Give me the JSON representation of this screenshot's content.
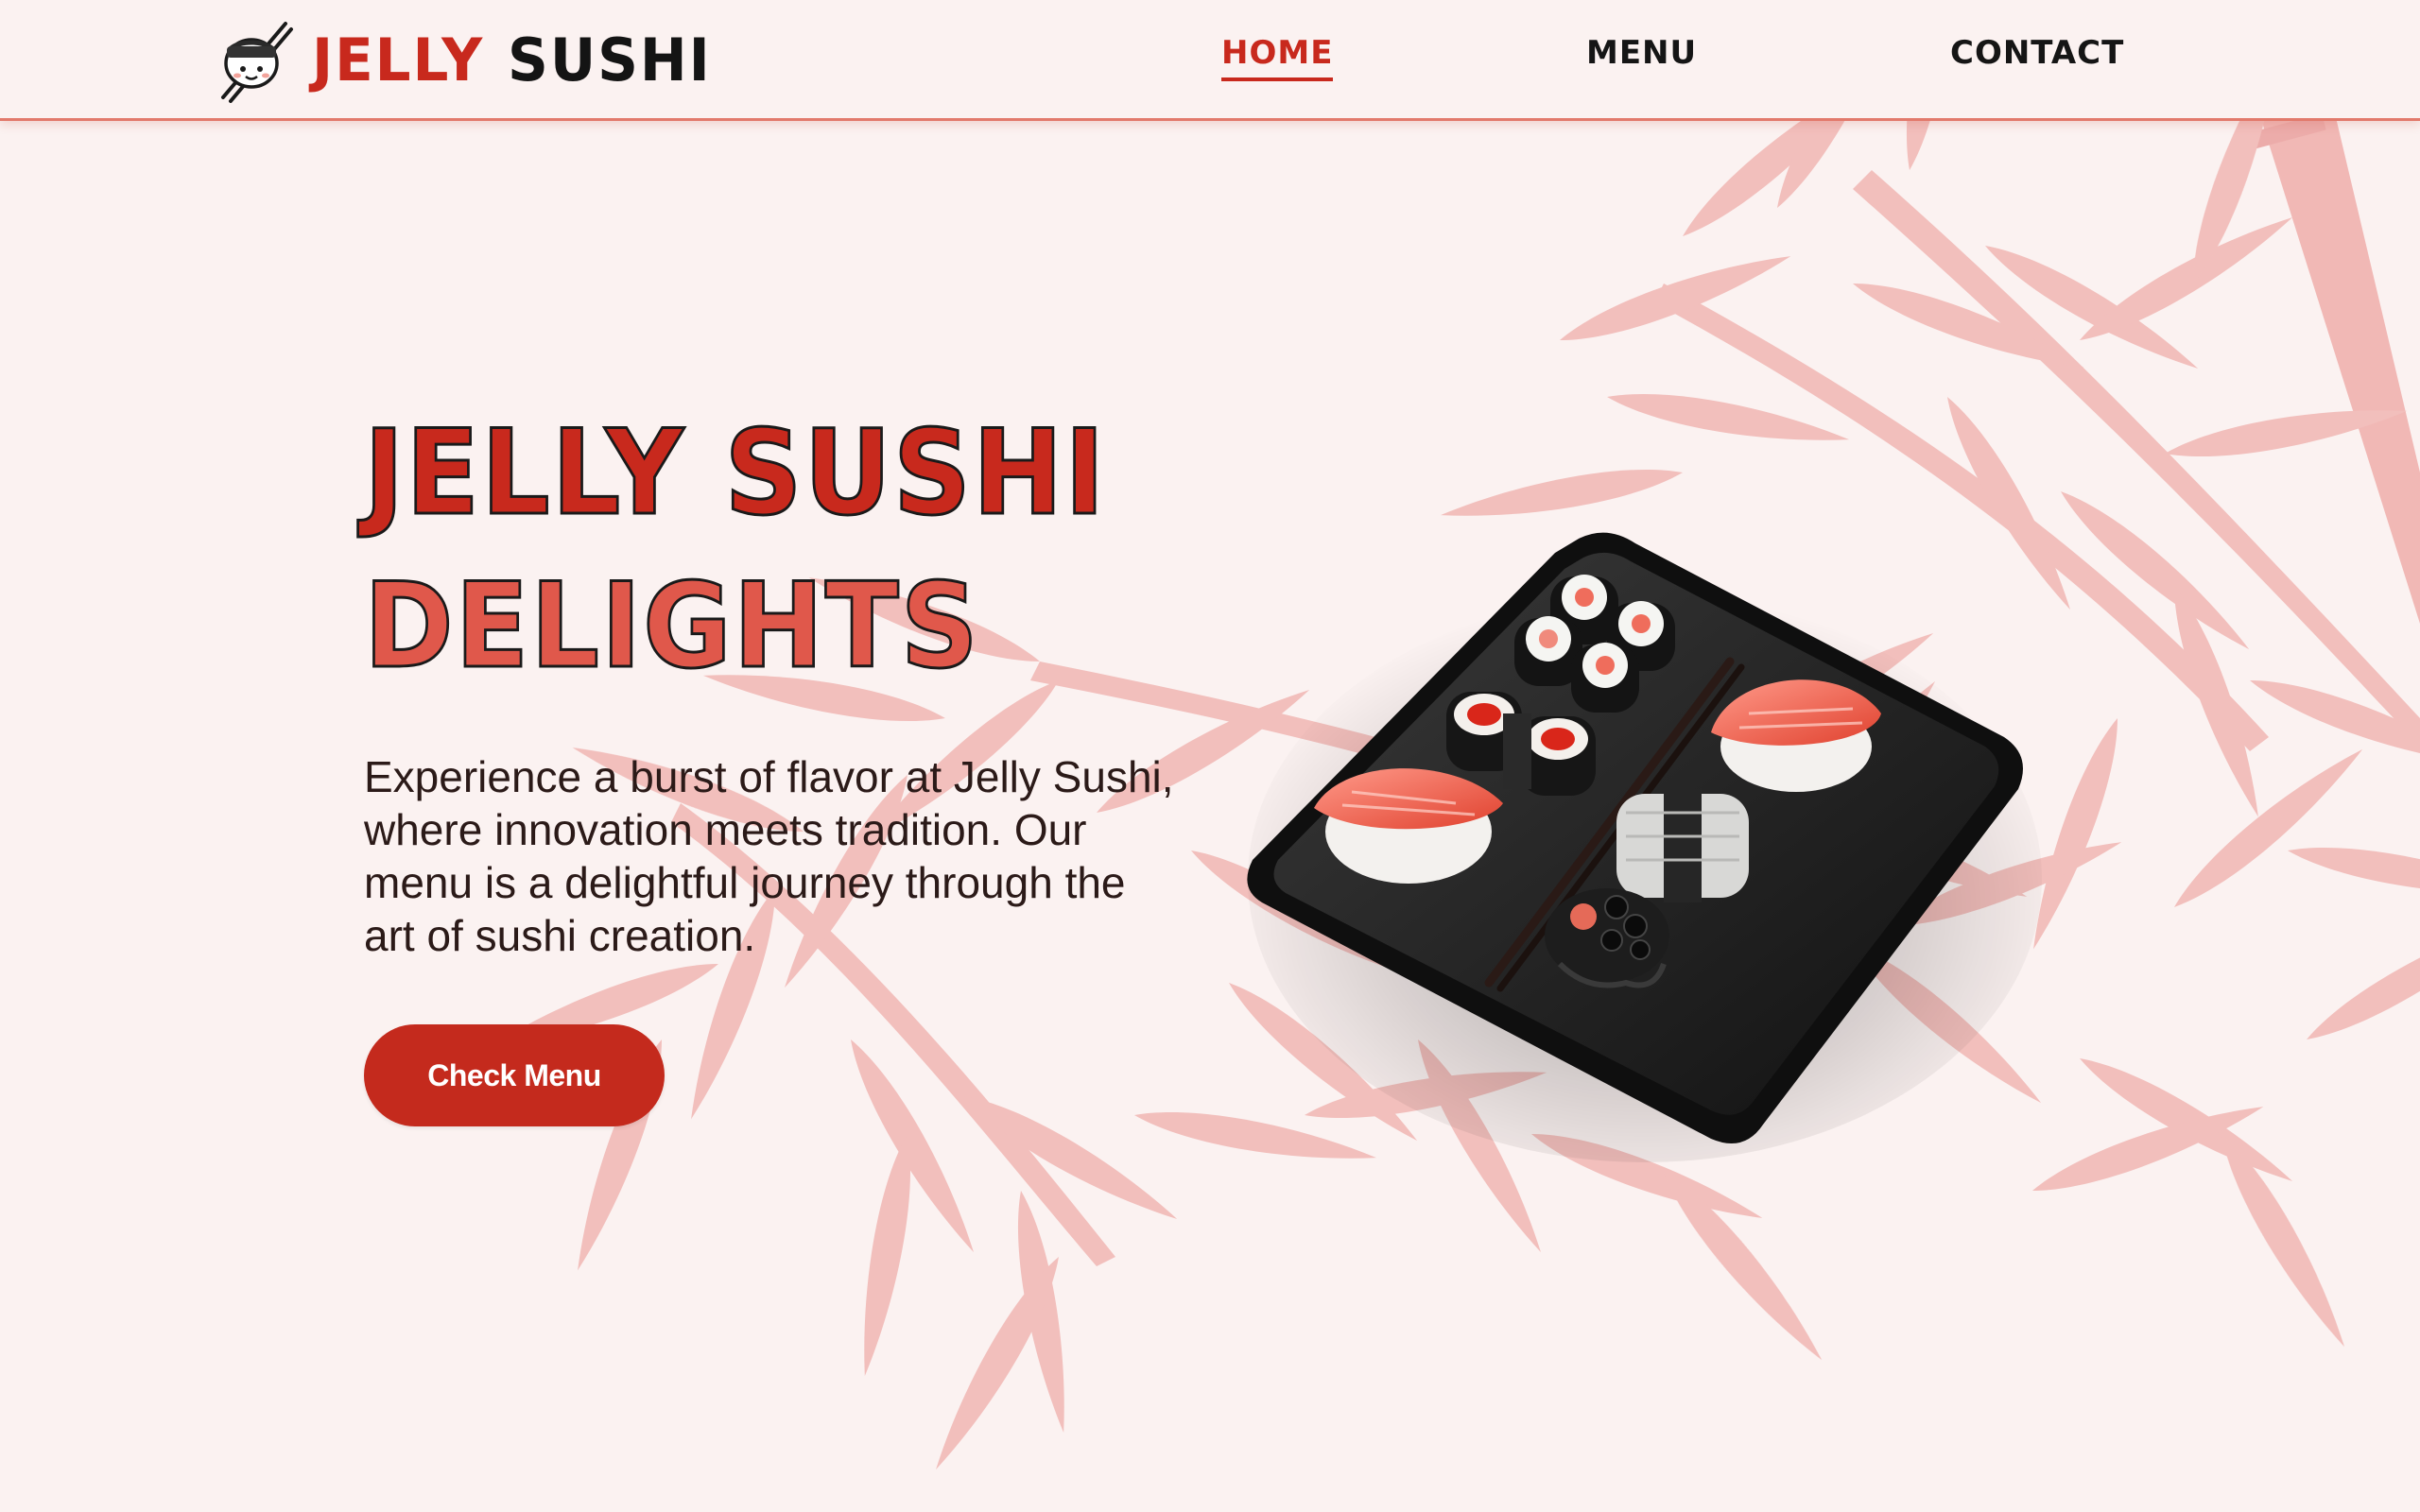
{
  "brand": {
    "name_part1": "JELLY",
    "name_part2": "SUSHI",
    "logo_icon": "sushi-mascot-chopsticks-icon",
    "accent_color": "#c8291d",
    "background_color": "#fbf2f1"
  },
  "nav": {
    "items": [
      {
        "label": "HOME",
        "active": true
      },
      {
        "label": "MENU",
        "active": false
      },
      {
        "label": "CONTACT",
        "active": false
      }
    ]
  },
  "hero": {
    "title_line1": "JELLY SUSHI",
    "title_line2": "DELIGHTS",
    "description": "Experience a burst of flavor at Jelly Sushi, where innovation meets tradition. Our menu is a delightful journey through the art of sushi creation.",
    "cta_label": "Check Menu",
    "image": "sushi-plate-image",
    "background_image": "bamboo-leaves-image"
  }
}
